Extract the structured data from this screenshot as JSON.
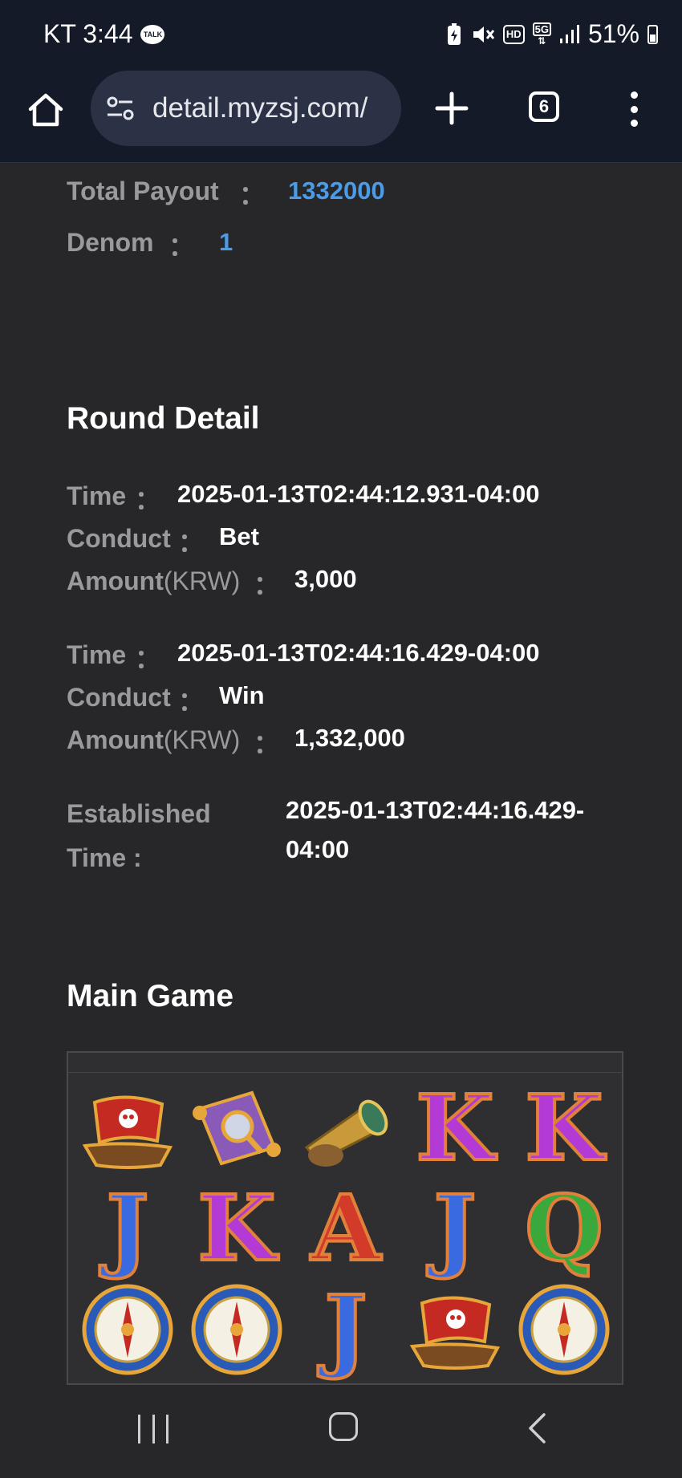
{
  "status_bar": {
    "carrier_time": "KT 3:44",
    "talk_badge": "TALK",
    "hd_badge": "HD",
    "net_badge": "5G",
    "battery": "51%",
    "icons": [
      "kakaotalk-icon",
      "battery-saver-icon",
      "mute-icon",
      "hd-voice-icon",
      "5g-icon",
      "signal-icon",
      "battery-icon"
    ]
  },
  "browser": {
    "url": "detail.myzsj.com/",
    "tab_count": "6",
    "icons": [
      "home-icon",
      "site-settings-icon",
      "new-tab-icon",
      "tabs-icon",
      "menu-icon"
    ]
  },
  "summary": {
    "total_payout_label": "Total Payout",
    "total_payout_sep": "：",
    "total_payout_value": "1332000",
    "denom_label": "Denom",
    "denom_sep": "：",
    "denom_value": "1"
  },
  "round_detail": {
    "title": "Round Detail",
    "entries": [
      {
        "time_label": "Time",
        "time_sep": "：",
        "time_value": "2025-01-13T02:44:12.931-04:00",
        "conduct_label": "Conduct",
        "conduct_sep": "：",
        "conduct_value": "Bet",
        "amount_label": "Amount",
        "amount_unit": "(KRW)",
        "amount_sep": "：",
        "amount_value": "3,000"
      },
      {
        "time_label": "Time",
        "time_sep": "：",
        "time_value": "2025-01-13T02:44:16.429-04:00",
        "conduct_label": "Conduct",
        "conduct_sep": "：",
        "conduct_value": "Win",
        "amount_label": "Amount",
        "amount_unit": "(KRW)",
        "amount_sep": "：",
        "amount_value": "1,332,000"
      }
    ],
    "established_label_1": "Established",
    "established_label_2": "Time :",
    "established_value_1": "2025-01-13T02:44:16.429-",
    "established_value_2": "04:00"
  },
  "main_game": {
    "title": "Main Game",
    "symbols": [
      [
        "pirate-ship",
        "treasure-map",
        "spyglass",
        "K",
        "K"
      ],
      [
        "J",
        "K",
        "A",
        "J",
        "Q"
      ],
      [
        "compass",
        "compass",
        "J",
        "pirate-ship",
        "compass"
      ]
    ]
  },
  "nav": {
    "icons": [
      "recent-apps-icon",
      "home-button-icon",
      "back-icon"
    ]
  },
  "colors": {
    "background": "#272729",
    "bar": "#151a29",
    "label_gray": "#9a9a9c",
    "value_blue": "#4a9be8"
  }
}
